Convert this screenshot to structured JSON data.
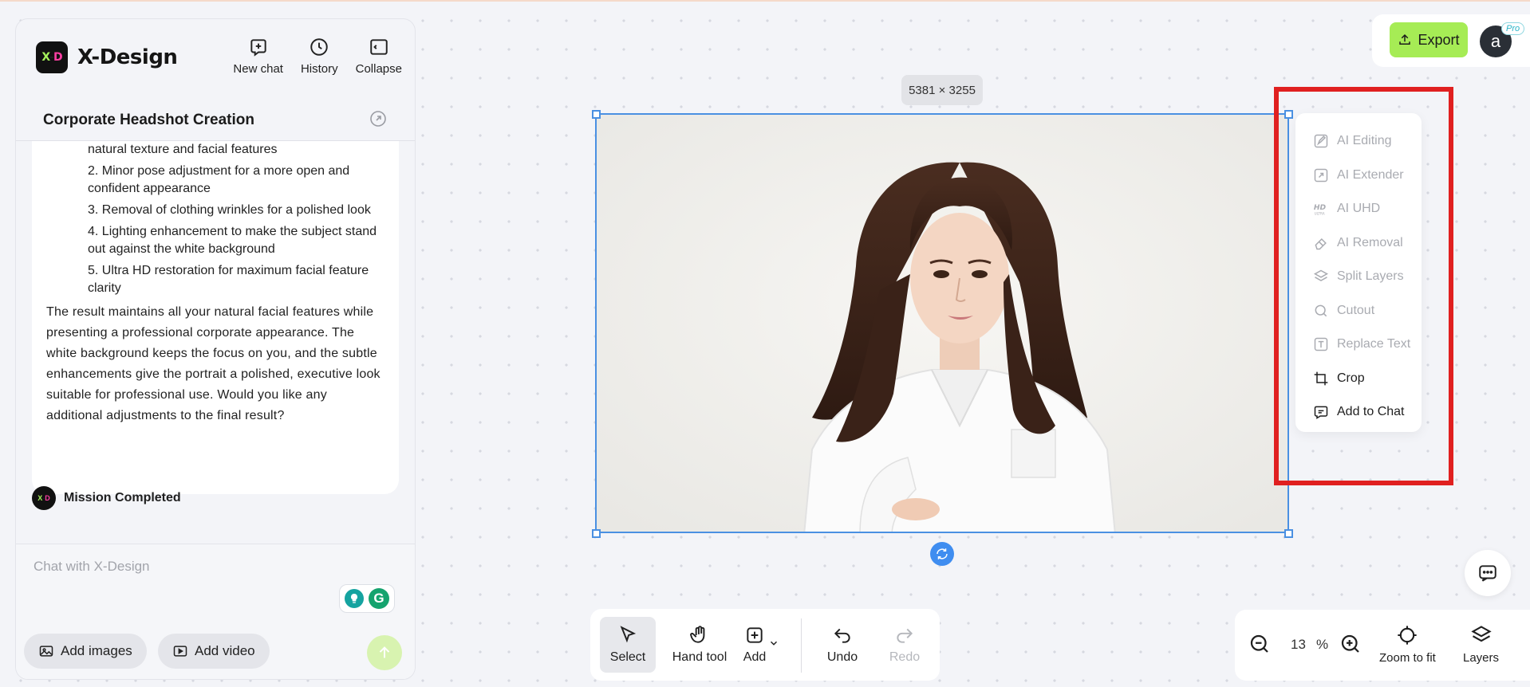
{
  "app": {
    "name": "X-Design",
    "logo_x": "X",
    "logo_d": "D",
    "top_actions": {
      "new_chat": "New chat",
      "history": "History",
      "collapse": "Collapse"
    }
  },
  "chat": {
    "title": "Corporate Headshot Creation",
    "list_items": [
      "natural texture and facial features",
      "2. Minor pose adjustment for a more open and confident appearance",
      "3. Removal of clothing wrinkles for a polished look",
      "4. Lighting enhancement to make the subject stand out against the white background",
      "5. Ultra HD restoration for maximum facial feature clarity"
    ],
    "paragraph": "The result maintains all your natural facial features while presenting a professional corporate appearance. The white background keeps the focus on you, and the subtle enhancements give the portrait a polished, executive look suitable for professional use. Would you like any additional adjustments to the final result?",
    "status": "Mission Completed",
    "input_placeholder": "Chat with X-Design",
    "add_images": "Add images",
    "add_video": "Add video"
  },
  "header": {
    "export_label": "Export",
    "avatar_letter": "a",
    "pro_badge": "Pro"
  },
  "canvas": {
    "image_dimensions": "5381 × 3255"
  },
  "context_menu": {
    "items": [
      {
        "label": "AI Editing",
        "icon": "ai-editing-icon",
        "enabled": false
      },
      {
        "label": "AI Extender",
        "icon": "ai-extender-icon",
        "enabled": false
      },
      {
        "label": "AI UHD",
        "icon": "hd-ultra-icon",
        "enabled": false
      },
      {
        "label": "AI Removal",
        "icon": "eraser-icon",
        "enabled": false
      },
      {
        "label": "Split Layers",
        "icon": "layers-icon",
        "enabled": false
      },
      {
        "label": "Cutout",
        "icon": "cutout-icon",
        "enabled": false
      },
      {
        "label": "Replace Text",
        "icon": "replace-text-icon",
        "enabled": false
      },
      {
        "label": "Crop",
        "icon": "crop-icon",
        "enabled": true
      },
      {
        "label": "Add to Chat",
        "icon": "chat-bubble-icon",
        "enabled": true
      }
    ]
  },
  "toolbar": {
    "select": "Select",
    "hand_tool": "Hand tool",
    "add": "Add",
    "undo": "Undo",
    "redo": "Redo"
  },
  "zoom": {
    "value": "13",
    "unit": "%",
    "zoom_to_fit": "Zoom to fit",
    "layers": "Layers"
  },
  "colors": {
    "accent_green": "#a6ec55",
    "selection_blue": "#4a90e2",
    "highlight_red": "#e02020"
  }
}
